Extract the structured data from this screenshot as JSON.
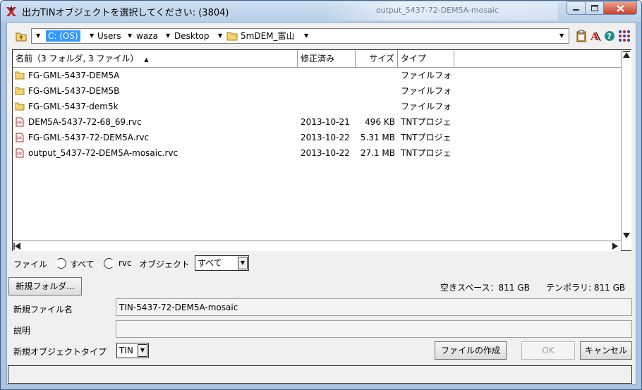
{
  "window": {
    "title": "出力TINオブジェクトを選択してください: (3804)",
    "background_window_title": "output_5437-72-DEM5A-mosaic"
  },
  "address": {
    "drive": "C: (OS)",
    "crumbs": [
      "Users",
      "waza",
      "Desktop",
      "5mDEM_富山"
    ]
  },
  "list": {
    "columns": {
      "name": "名前（3 フォルダ, 3 ファイル）",
      "modified": "修正済み",
      "size": "サイズ",
      "type": "タイプ"
    },
    "rows": [
      {
        "icon": "folder-icon",
        "name": "FG-GML-5437-DEM5A",
        "modified": "",
        "size": "",
        "type": "ファイルフォ"
      },
      {
        "icon": "folder-icon",
        "name": "FG-GML-5437-DEM5B",
        "modified": "",
        "size": "",
        "type": "ファイルフォ"
      },
      {
        "icon": "folder-icon",
        "name": "FG-GML-5437-dem5k",
        "modified": "",
        "size": "",
        "type": "ファイルフォ"
      },
      {
        "icon": "rvc-file-icon",
        "name": "DEM5A-5437-72-68_69.rvc",
        "modified": "2013-10-21",
        "size": "496 KB",
        "type": "TNTプロジェ"
      },
      {
        "icon": "rvc-file-icon",
        "name": "FG-GML-5437-72-DEM5A.rvc",
        "modified": "2013-10-22",
        "size": "5.31 MB",
        "type": "TNTプロジェ"
      },
      {
        "icon": "rvc-file-icon",
        "name": "output_5437-72-DEM5A-mosaic.rvc",
        "modified": "2013-10-22",
        "size": "27.1 MB",
        "type": "TNTプロジェ"
      }
    ]
  },
  "filter": {
    "file_label": "ファイル",
    "all_label": "すべて",
    "rvc_label": "rvc",
    "object_label": "オブジェクト",
    "object_value": "すべて"
  },
  "new_folder_button": "新規フォルダ...",
  "space": {
    "free": "空きスペース：811 GB",
    "temp": "テンポラリ: 811 GB"
  },
  "new_file": {
    "label": "新規ファイル名",
    "value": "TIN-5437-72-DEM5A-mosaic"
  },
  "description": {
    "label": "説明",
    "value": ""
  },
  "object_type": {
    "label": "新規オブジェクトタイプ",
    "value": "TIN"
  },
  "buttons": {
    "create": "ファイルの作成",
    "ok": "OK",
    "cancel": "キャンセル"
  },
  "status_text": ""
}
